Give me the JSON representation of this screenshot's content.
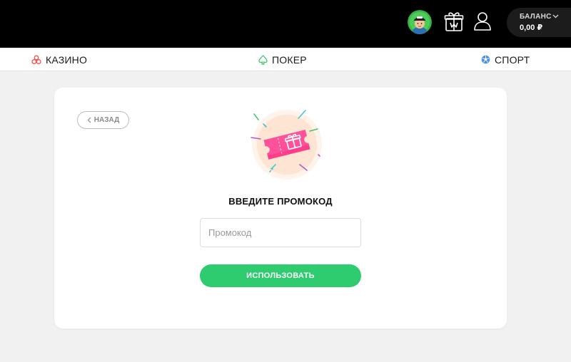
{
  "header": {
    "avatar_icon": "user-avatar",
    "gift_icon": "gift-icon",
    "profile_icon": "user-icon",
    "balance_label": "БАЛАНС",
    "balance_value": "0,00 ₽"
  },
  "nav": {
    "items": [
      {
        "label": "КАЗИНО",
        "icon": "clover-icon"
      },
      {
        "label": "ПОКЕР",
        "icon": "spade-icon"
      },
      {
        "label": "СПОРТ",
        "icon": "soccer-ball-icon"
      }
    ]
  },
  "promo": {
    "back_label": "НАЗАД",
    "title": "ВВЕДИТЕ ПРОМОКОД",
    "input_value": "",
    "input_placeholder": "Промокод",
    "submit_label": "ИСПОЛЬЗОВАТЬ",
    "illustration_icon": "gift-ticket-icon"
  },
  "colors": {
    "accent_green": "#2fcb6f",
    "header_bg": "#000000",
    "page_bg": "#f1f1f1",
    "ticket_pink": "#ff3d8b"
  }
}
